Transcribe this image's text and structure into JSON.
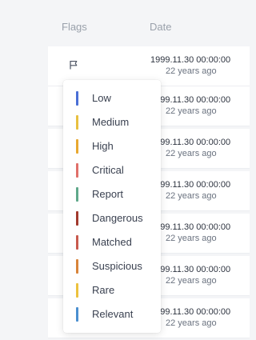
{
  "table": {
    "headers": {
      "flags": "Flags",
      "date": "Date"
    },
    "rows": [
      {
        "date": "1999.11.30 00:00:00",
        "ago": "22 years ago"
      },
      {
        "date": "1999.11.30 00:00:00",
        "ago": "22 years ago"
      },
      {
        "date": "1999.11.30 00:00:00",
        "ago": "22 years ago"
      },
      {
        "date": "1999.11.30 00:00:00",
        "ago": "22 years ago"
      },
      {
        "date": "1999.11.30 00:00:00",
        "ago": "22 years ago"
      },
      {
        "date": "1999.11.30 00:00:00",
        "ago": "22 years ago"
      },
      {
        "date": "1999.11.30 00:00:00",
        "ago": "22 years ago"
      }
    ]
  },
  "flag_menu": {
    "icon": "flag-icon",
    "options": [
      {
        "label": "Low",
        "color": "#4a6fd6"
      },
      {
        "label": "Medium",
        "color": "#e8c040"
      },
      {
        "label": "High",
        "color": "#e8a830"
      },
      {
        "label": "Critical",
        "color": "#e0706a"
      },
      {
        "label": "Report",
        "color": "#5fa88a"
      },
      {
        "label": "Dangerous",
        "color": "#a23a2e"
      },
      {
        "label": "Matched",
        "color": "#c85a4e"
      },
      {
        "label": "Suspicious",
        "color": "#d8843a"
      },
      {
        "label": "Rare",
        "color": "#ecc23e"
      },
      {
        "label": "Relevant",
        "color": "#4a8fd0"
      }
    ]
  }
}
